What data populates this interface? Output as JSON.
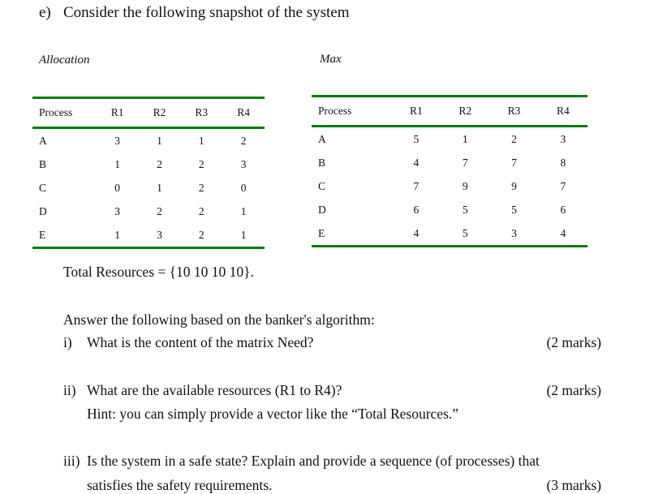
{
  "question": {
    "label": "e)",
    "text": "Consider the following snapshot of the system"
  },
  "allocation": {
    "caption": "Allocation",
    "headers": [
      "Process",
      "R1",
      "R2",
      "R3",
      "R4"
    ],
    "rows": [
      [
        "A",
        "3",
        "1",
        "1",
        "2"
      ],
      [
        "B",
        "1",
        "2",
        "2",
        "3"
      ],
      [
        "C",
        "0",
        "1",
        "2",
        "0"
      ],
      [
        "D",
        "3",
        "2",
        "2",
        "1"
      ],
      [
        "E",
        "1",
        "3",
        "2",
        "1"
      ]
    ]
  },
  "max": {
    "caption": "Max",
    "headers": [
      "Process",
      "R1",
      "R2",
      "R3",
      "R4"
    ],
    "rows": [
      [
        "A",
        "5",
        "1",
        "2",
        "3"
      ],
      [
        "B",
        "4",
        "7",
        "7",
        "8"
      ],
      [
        "C",
        "7",
        "9",
        "9",
        "7"
      ],
      [
        "D",
        "6",
        "5",
        "5",
        "6"
      ],
      [
        "E",
        "4",
        "5",
        "3",
        "4"
      ]
    ]
  },
  "total_resources": "Total Resources = {10 10 10 10}.",
  "intro": "Answer the following based on the banker's algorithm:",
  "subquestions": [
    {
      "num": "i)",
      "text": "What is the content of the matrix Need?",
      "marks": "(2 marks)"
    },
    {
      "num": "ii)",
      "text": "What are the available resources (R1 to R4)?",
      "hint": "Hint: you can simply provide a vector like the “Total Resources.”",
      "marks": "(2 marks)"
    },
    {
      "num": "iii)",
      "text": "Is the system in a safe state? Explain and provide a sequence (of processes) that",
      "text2": "satisfies the safety requirements.",
      "marks": "(3 marks)"
    }
  ]
}
